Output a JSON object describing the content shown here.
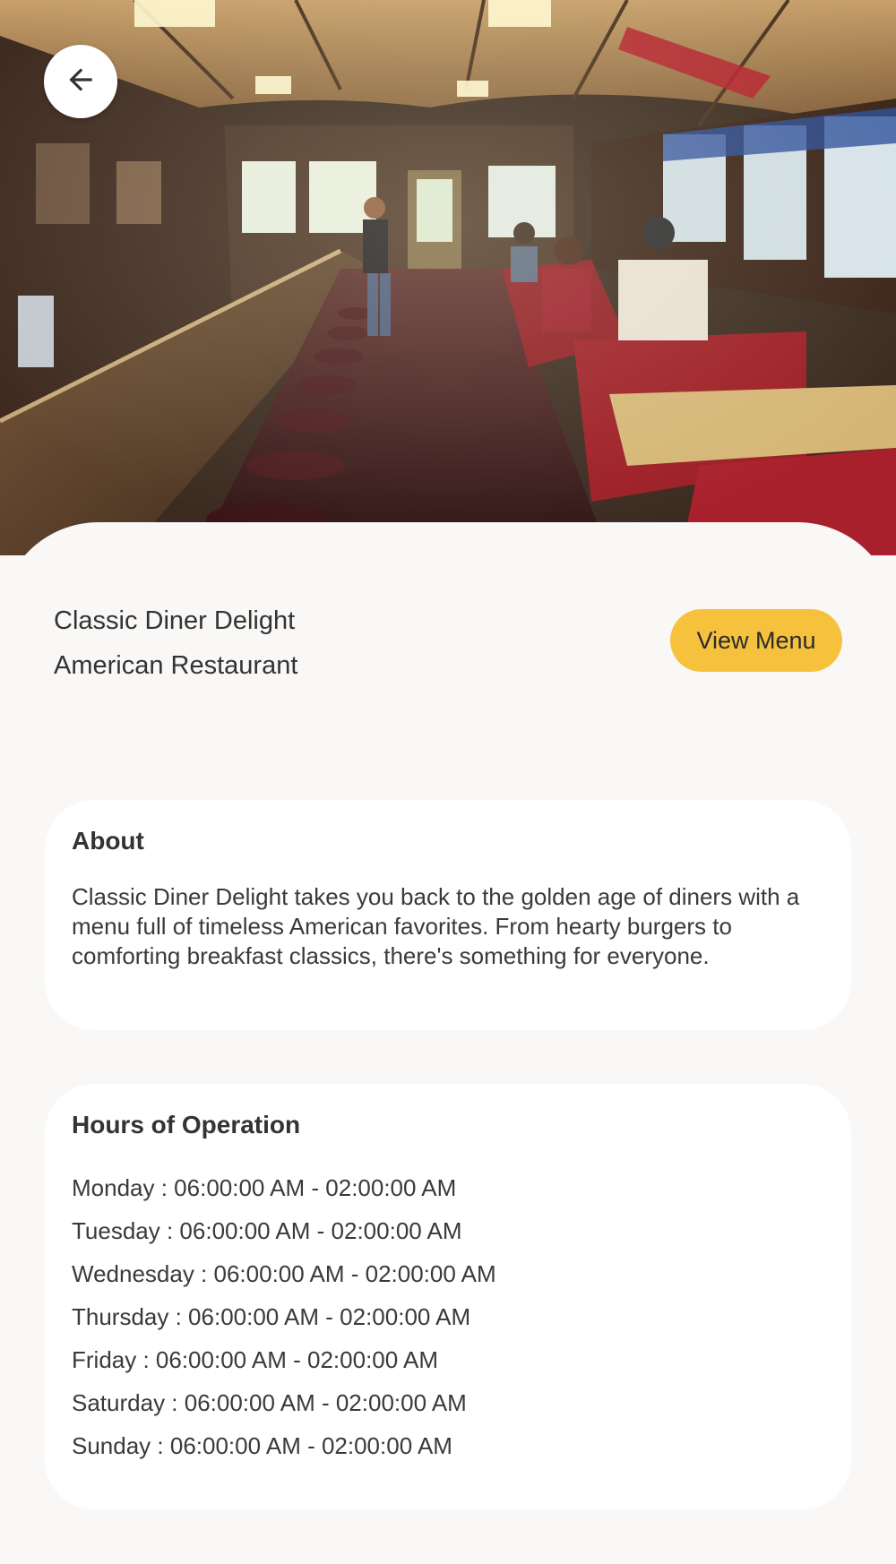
{
  "header": {
    "hero_image": "diner-interior-photo",
    "back_icon": "arrow-left-icon"
  },
  "restaurant": {
    "name": "Classic Diner Delight",
    "category": "American Restaurant",
    "view_menu_label": "View Menu"
  },
  "about": {
    "title": "About",
    "text": "Classic Diner Delight takes you back to the golden age of diners with a menu full of timeless American favorites. From hearty burgers to comforting breakfast classics, there's something for everyone."
  },
  "hours": {
    "title": "Hours of Operation",
    "items": [
      "Monday : 06:00:00 AM - 02:00:00 AM",
      "Tuesday : 06:00:00 AM - 02:00:00 AM",
      "Wednesday : 06:00:00 AM - 02:00:00 AM",
      "Thursday : 06:00:00 AM - 02:00:00 AM",
      "Friday : 06:00:00 AM - 02:00:00 AM",
      "Saturday : 06:00:00 AM - 02:00:00 AM",
      "Sunday : 06:00:00 AM - 02:00:00 AM"
    ]
  },
  "colors": {
    "accent": "#f6c23e",
    "background": "#f9f8f7",
    "card": "#ffffff"
  }
}
